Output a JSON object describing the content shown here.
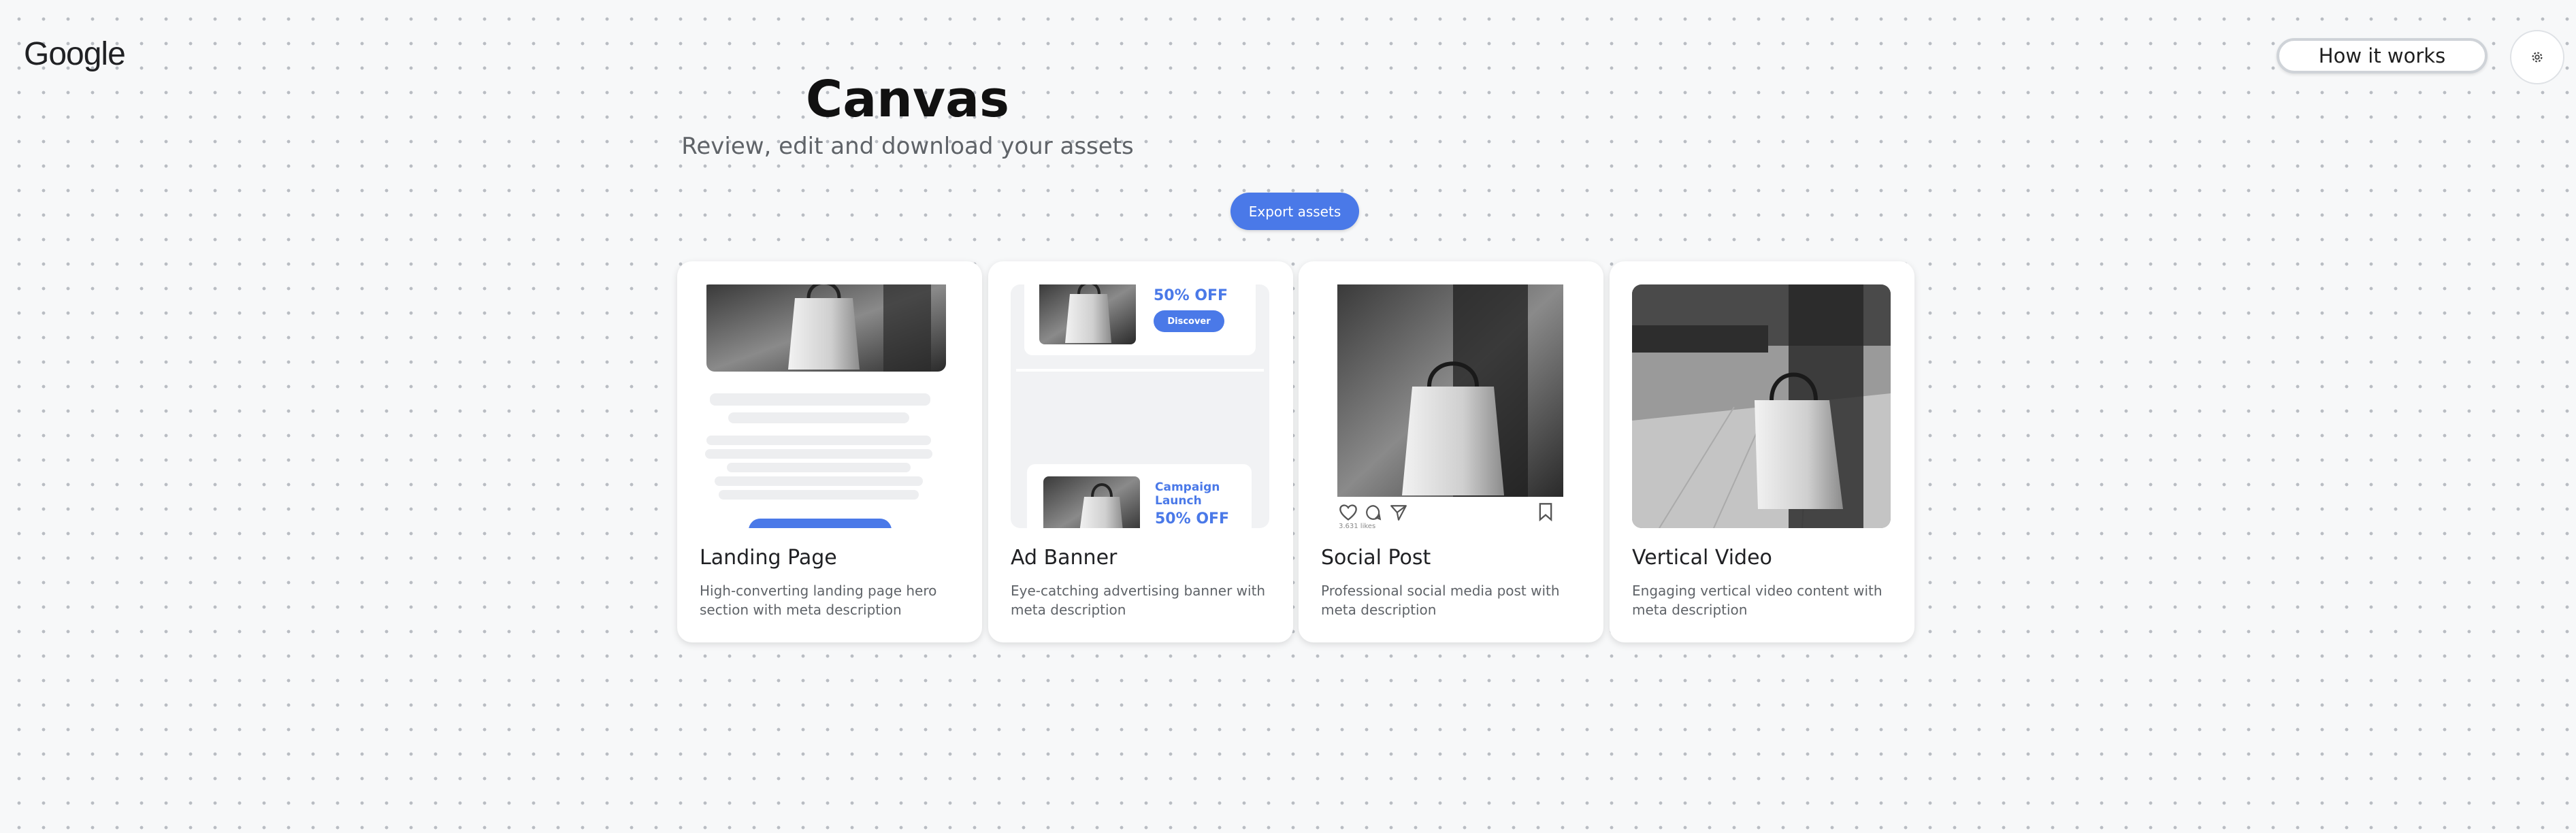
{
  "brand": {
    "logo_text": "Google"
  },
  "header": {
    "how_it_works": "How it works",
    "settings_icon": "gear-icon"
  },
  "page": {
    "title": "Canvas",
    "subtitle": "Review, edit and download your assets",
    "export_button": "Export assets"
  },
  "cards": [
    {
      "title": "Landing Page",
      "description": "High-converting landing page hero section with meta description"
    },
    {
      "title": "Ad Banner",
      "description": "Eye-catching advertising banner with meta description",
      "ad1": {
        "offer": "50% OFF",
        "cta": "Discover"
      },
      "ad2": {
        "heading": "Campaign Launch",
        "offer": "50% OFF"
      }
    },
    {
      "title": "Social Post",
      "description": "Professional social media post with meta description",
      "likes": "3,631 likes"
    },
    {
      "title": "Vertical Video",
      "description": "Engaging vertical video content with meta description"
    }
  ],
  "colors": {
    "accent": "#4a79e8",
    "background": "#f7f8f9"
  }
}
